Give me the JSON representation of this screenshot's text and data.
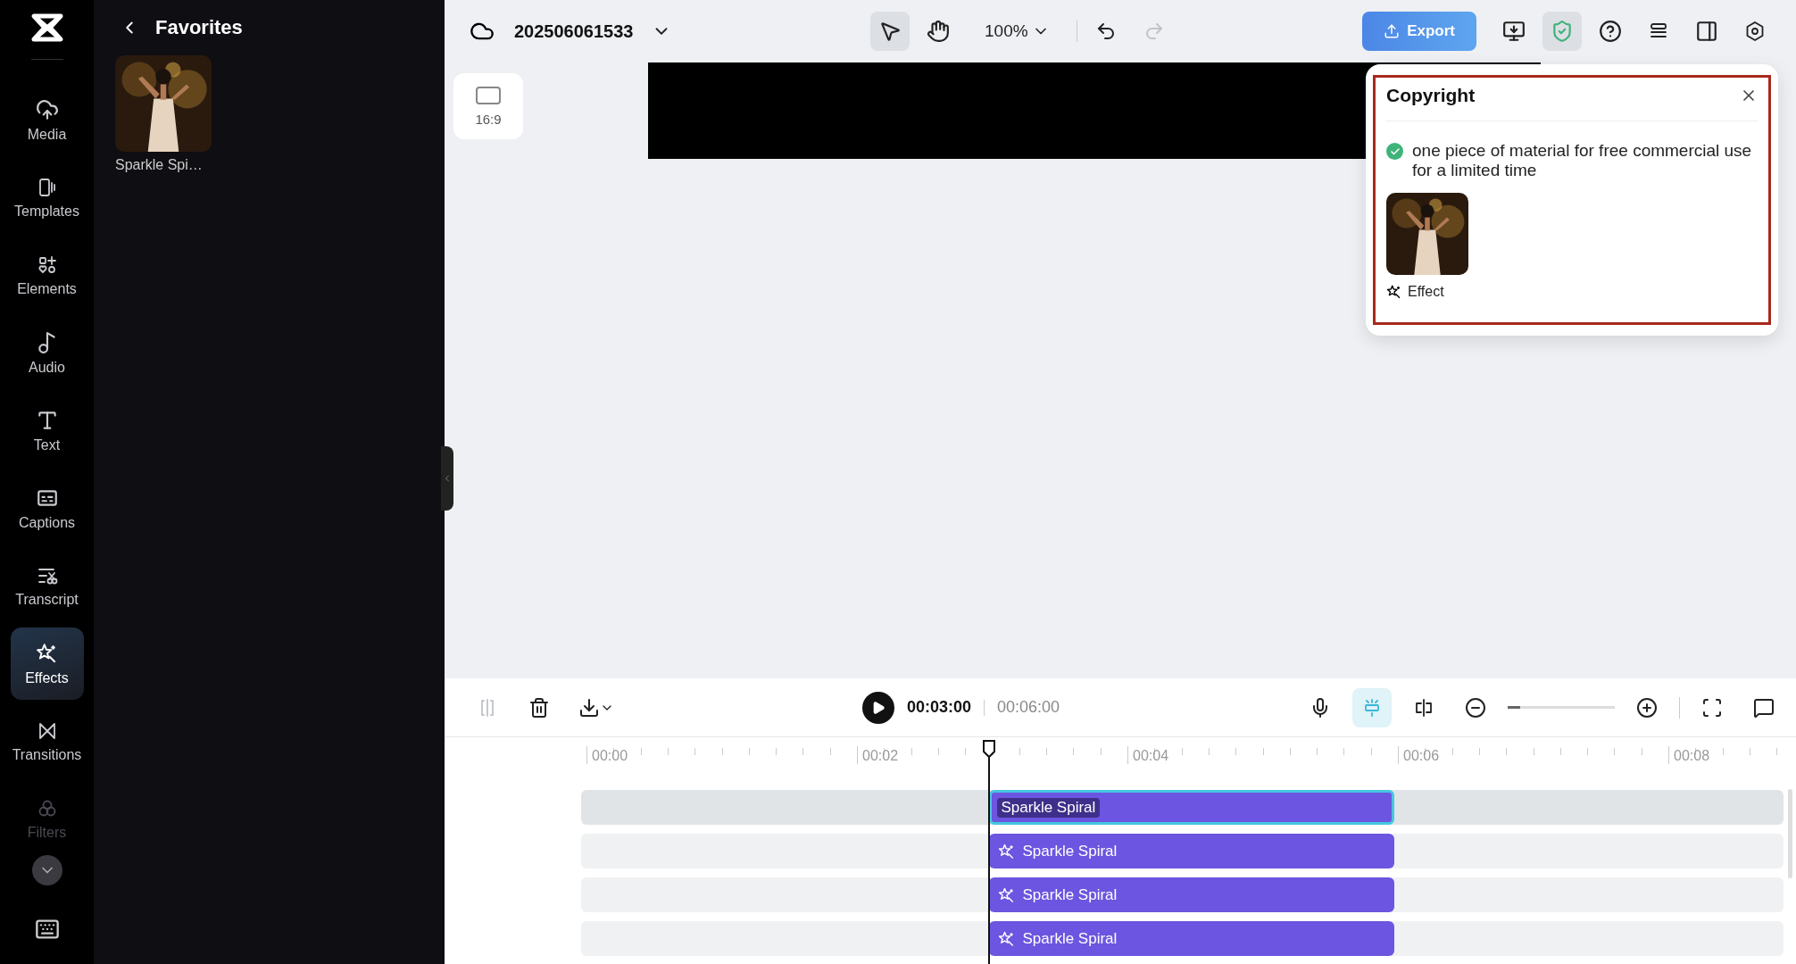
{
  "nav": [
    {
      "label": "Media",
      "selected": false,
      "dimmed": false
    },
    {
      "label": "Templates",
      "selected": false,
      "dimmed": false
    },
    {
      "label": "Elements",
      "selected": false,
      "dimmed": false
    },
    {
      "label": "Audio",
      "selected": false,
      "dimmed": false
    },
    {
      "label": "Text",
      "selected": false,
      "dimmed": false
    },
    {
      "label": "Captions",
      "selected": false,
      "dimmed": false
    },
    {
      "label": "Transcript",
      "selected": false,
      "dimmed": false
    },
    {
      "label": "Effects",
      "selected": true,
      "dimmed": false
    },
    {
      "label": "Transitions",
      "selected": false,
      "dimmed": false
    },
    {
      "label": "Filters",
      "selected": false,
      "dimmed": true
    }
  ],
  "favorites": {
    "title": "Favorites",
    "items": [
      {
        "label": "Sparkle Spi…",
        "kind": "picture"
      }
    ]
  },
  "topbar": {
    "project_title": "202506061533",
    "tools": [
      {
        "kind": "pointer",
        "selected": true
      },
      {
        "kind": "hand",
        "selected": false
      }
    ],
    "zoom": "100%",
    "undo": {
      "disabled": false
    },
    "redo": {
      "disabled": true
    },
    "export": "Export",
    "copyright_check": {
      "selected": true
    }
  },
  "canvas": {
    "ratio": "16:9"
  },
  "copyright": {
    "title": "Copyright",
    "message": "one piece of material for free commercial use for a limited time",
    "item_label": "Effect"
  },
  "timeline": {
    "split": {
      "disabled": true
    },
    "current_time": "00:03:00",
    "total_time": "00:06:00",
    "auto_snap": {
      "selected": true
    },
    "zoom": {
      "level": 0.12
    },
    "ruler": [
      "00:00",
      "00:02",
      "00:04",
      "00:06",
      "00:08"
    ],
    "clips": [
      {
        "label": "Sparkle Spiral",
        "selected": true
      },
      {
        "label": "Sparkle Spiral",
        "selected": false
      },
      {
        "label": "Sparkle Spiral",
        "selected": false
      },
      {
        "label": "Sparkle Spiral",
        "selected": false
      }
    ]
  }
}
